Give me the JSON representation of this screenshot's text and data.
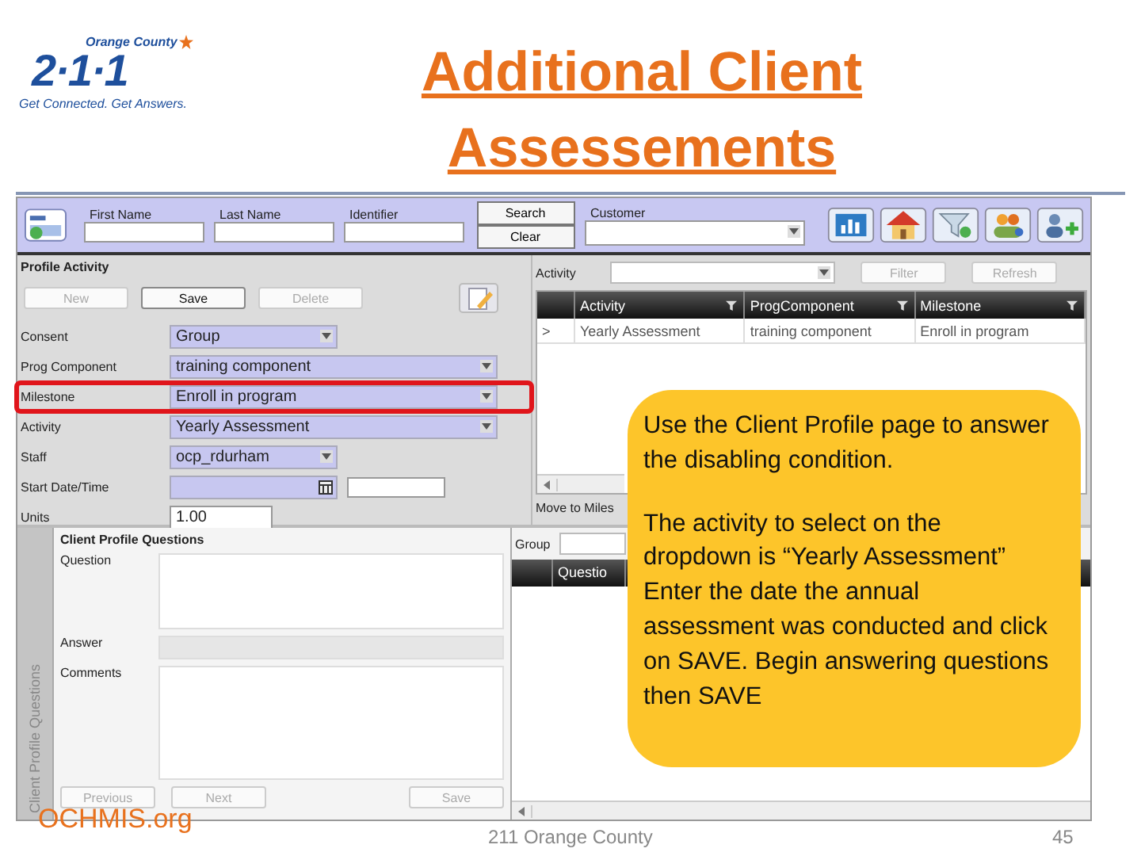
{
  "logo": {
    "region": "Orange County",
    "number": "2·1·1",
    "tagline": "Get Connected. Get Answers."
  },
  "title": "Additional Client Assessements",
  "search_bar": {
    "fields": [
      {
        "label": "First Name"
      },
      {
        "label": "Last Name"
      },
      {
        "label": "Identifier"
      }
    ],
    "buttons": [
      "Search",
      "Clear"
    ],
    "customer_label": "Customer"
  },
  "profile_activity": {
    "title": "Profile Activity",
    "buttons": [
      {
        "label": "New",
        "disabled": true
      },
      {
        "label": "Save",
        "disabled": false
      },
      {
        "label": "Delete",
        "disabled": true
      }
    ],
    "rows": [
      {
        "label": "Consent",
        "kind": "select",
        "value": "Group",
        "wide": false,
        "highlighted": false
      },
      {
        "label": "Prog Component",
        "kind": "select",
        "value": "training component",
        "wide": true,
        "highlighted": false
      },
      {
        "label": "Milestone",
        "kind": "select",
        "value": "Enroll in program",
        "wide": true,
        "highlighted": true
      },
      {
        "label": "Activity",
        "kind": "select",
        "value": "Yearly Assessment",
        "wide": true,
        "highlighted": false
      },
      {
        "label": "Staff",
        "kind": "select",
        "value": "ocp_rdurham",
        "wide": false,
        "highlighted": false
      },
      {
        "label": "Start Date/Time",
        "kind": "date",
        "value": "",
        "highlighted": false
      },
      {
        "label": "Units",
        "kind": "text",
        "value": "1.00",
        "highlighted": false
      }
    ]
  },
  "activity_list": {
    "filter_label": "Activity",
    "buttons": [
      {
        "label": "Filter",
        "disabled": true
      },
      {
        "label": "Refresh",
        "disabled": true
      }
    ],
    "columns": [
      "Activity",
      "ProgComponent",
      "Milestone"
    ],
    "rows": [
      {
        "marker": ">",
        "cells": [
          "Yearly Assessment",
          "training component",
          "Enroll in program"
        ]
      }
    ],
    "move_label": "Move to Miles"
  },
  "questions": {
    "tab": "Client Profile Questions",
    "title": "Client Profile Questions",
    "labels": [
      "Question",
      "Answer",
      "Comments"
    ],
    "buttons": [
      {
        "label": "Previous",
        "disabled": true
      },
      {
        "label": "Next",
        "disabled": true
      },
      {
        "label": "Save",
        "disabled": true
      }
    ],
    "group_label": "Group",
    "column": "Questio"
  },
  "callout": [
    "Use the Client Profile page to answer the disabling condition.",
    "The activity to select on the dropdown is “Yearly Assessment”",
    "Enter the date the annual assessment was conducted and click on SAVE. Begin answering questions then SAVE"
  ],
  "footer": {
    "site": "OCHMIS.org",
    "center": "211 Orange County",
    "page": "45"
  }
}
